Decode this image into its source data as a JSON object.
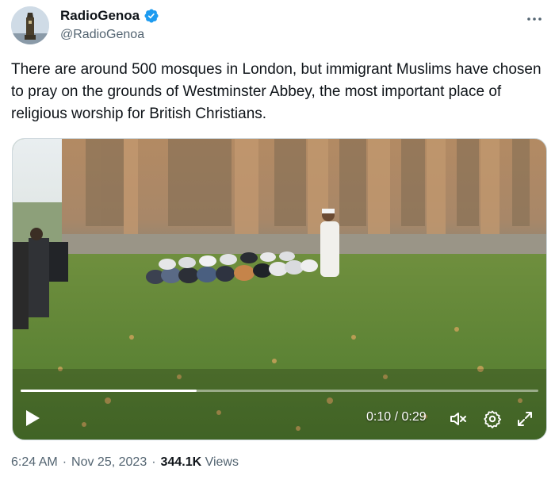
{
  "author": {
    "display_name": "RadioGenoa",
    "handle": "@RadioGenoa",
    "verified_icon": "verified-badge-icon",
    "avatar_icon": "tower-avatar"
  },
  "tweet": {
    "text": "There are around 500 mosques in London, but immigrant Muslims have chosen to pray on the grounds of Westminster Abbey, the most important place of religious worship for British Christians."
  },
  "video": {
    "current_time": "0:10",
    "separator": " / ",
    "duration": "0:29",
    "progress_percent": 34,
    "controls": [
      "play-icon",
      "mute-icon",
      "settings-icon",
      "fullscreen-icon"
    ]
  },
  "meta": {
    "time": "6:24 AM",
    "dot1": "·",
    "date": "Nov 25, 2023",
    "dot2": "·",
    "views_count": "344.1K",
    "views_label": "Views"
  },
  "colors": {
    "verified": "#1d9bf0",
    "text": "#0f1419",
    "secondary": "#536471"
  }
}
